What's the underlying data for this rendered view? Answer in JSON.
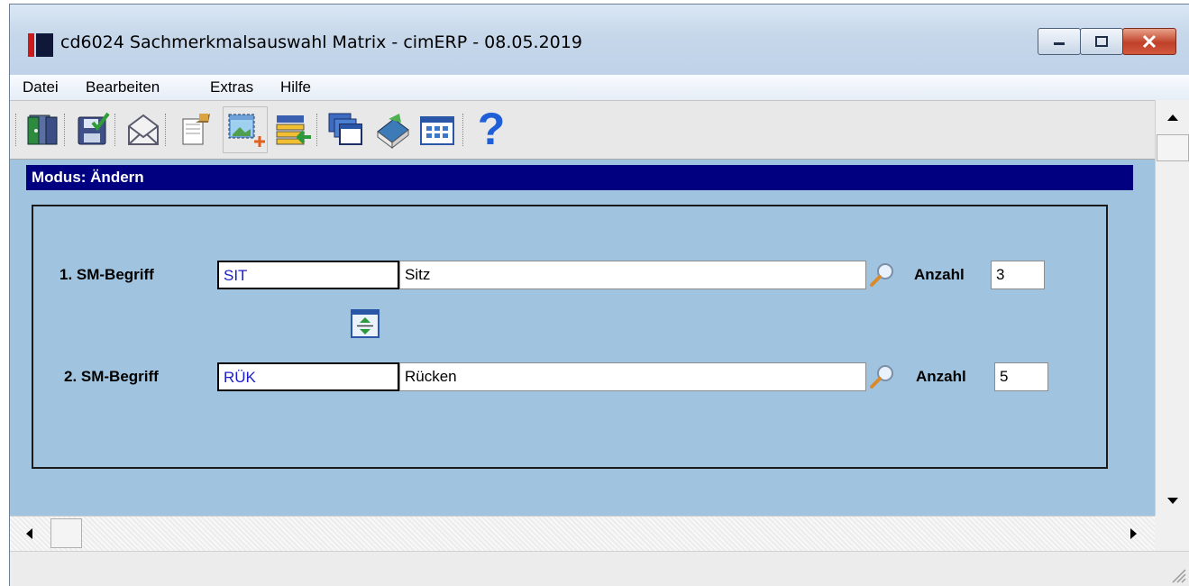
{
  "window": {
    "title": "cd6024 Sachmerkmalsauswahl Matrix - cimERP - 08.05.2019"
  },
  "menu": {
    "items": [
      "Datei",
      "Bearbeiten",
      "Extras",
      "Hilfe"
    ]
  },
  "toolbar": {
    "icons": [
      "exit-door-icon",
      "save-icon",
      "mail-icon",
      "paste-icon",
      "new-window-icon",
      "list-import-icon",
      "copy-windows-icon",
      "book-icon",
      "table-icon",
      "help-icon"
    ],
    "help_label": "?"
  },
  "mode_bar": {
    "text": "Modus: Ändern"
  },
  "form": {
    "row1": {
      "label": "1. SM-Begriff",
      "code": "SIT",
      "description": "Sitz",
      "count_label": "Anzahl",
      "count": "3"
    },
    "row2": {
      "label": "2. SM-Begriff",
      "code": "RÜK",
      "description": "Rücken",
      "count_label": "Anzahl",
      "count": "5"
    }
  },
  "colors": {
    "mode_bar_bg": "#000080",
    "content_bg": "#a0c4df",
    "code_text": "#1c1cc8",
    "close_button": "#c0412a"
  }
}
